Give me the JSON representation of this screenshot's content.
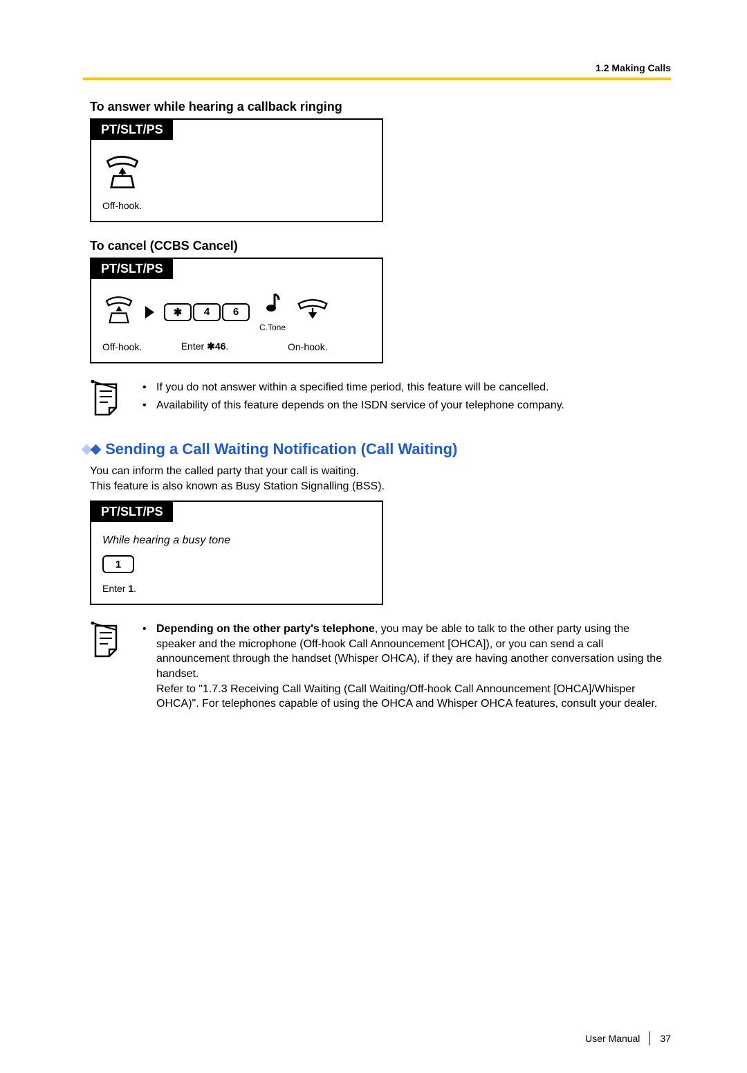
{
  "header": {
    "section": "1.2 Making Calls"
  },
  "subsection1": {
    "title": "To answer while hearing a callback ringing",
    "box_label": "PT/SLT/PS",
    "step_label": "Off-hook."
  },
  "subsection2": {
    "title": "To cancel (CCBS Cancel)",
    "box_label": "PT/SLT/PS",
    "offhook_label": "Off-hook.",
    "enter_label_prefix": "Enter ",
    "enter_code": "46",
    "enter_label_suffix": ".",
    "ctone_label": "C.Tone",
    "onhook_label": "On-hook.",
    "keys": {
      "star": "✱",
      "k4": "4",
      "k6": "6"
    }
  },
  "notes1": {
    "b1": "If you do not answer within a specified time period, this feature will be cancelled.",
    "b2": "Availability of this feature depends on the ISDN service of your telephone company."
  },
  "heading2": "Sending a Call Waiting Notification (Call Waiting)",
  "para2a": "You can inform the called party that your call is waiting.",
  "para2b": "This feature is also known as Busy Station Signalling (BSS).",
  "subsection3": {
    "box_label": "PT/SLT/PS",
    "context": "While hearing a busy tone",
    "key1": "1",
    "enter_label_prefix": "Enter ",
    "enter_code": "1",
    "enter_label_suffix": "."
  },
  "notes2": {
    "lead_bold": "Depending on the other party's telephone",
    "lead_rest": ", you may be able to talk to the other party using the speaker and the microphone (Off-hook Call Announcement [OHCA]), or you can send a call announcement through the handset (Whisper OHCA), if they are having another conversation using the handset.",
    "para2": "Refer to \"1.7.3 Receiving Call Waiting (Call Waiting/Off-hook Call Announcement [OHCA]/Whisper OHCA)\". For telephones capable of using the OHCA and Whisper OHCA features, consult your dealer."
  },
  "footer": {
    "doc": "User Manual",
    "page": "37"
  }
}
